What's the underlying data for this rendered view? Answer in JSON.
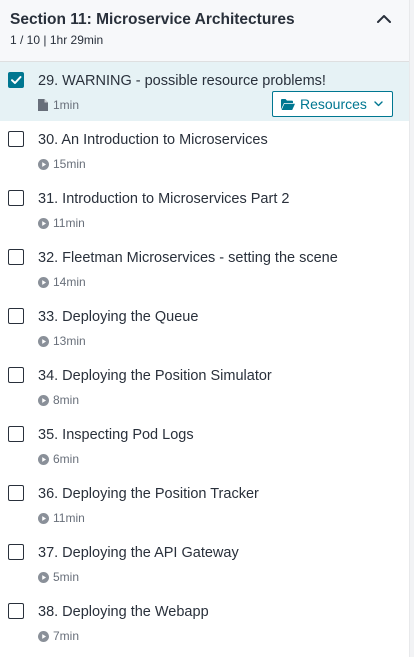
{
  "section": {
    "title": "Section 11: Microservice Architectures",
    "progress": "1 / 10",
    "separator": "|",
    "duration": "1hr 29min",
    "collapse_icon": "chevron-up-icon"
  },
  "colors": {
    "accent": "#007791",
    "active_row": "#e6f2f5",
    "header_bg": "#f7f8fa",
    "text": "#29303b",
    "muted": "#686f7a"
  },
  "resources": {
    "label": "Resources",
    "icon": "folder-open-icon",
    "chevron": "chevron-down-icon"
  },
  "lectures": [
    {
      "title": "29. WARNING - possible resource problems!",
      "duration": "1min",
      "completed": true,
      "type": "article",
      "icon": "file-icon"
    },
    {
      "title": "30. An Introduction to Microservices",
      "duration": "15min",
      "completed": false,
      "type": "video",
      "icon": "play-circle-icon"
    },
    {
      "title": "31. Introduction to Microservices Part 2",
      "duration": "11min",
      "completed": false,
      "type": "video",
      "icon": "play-circle-icon"
    },
    {
      "title": "32. Fleetman Microservices - setting the scene",
      "duration": "14min",
      "completed": false,
      "type": "video",
      "icon": "play-circle-icon"
    },
    {
      "title": "33. Deploying the Queue",
      "duration": "13min",
      "completed": false,
      "type": "video",
      "icon": "play-circle-icon"
    },
    {
      "title": "34. Deploying the Position Simulator",
      "duration": "8min",
      "completed": false,
      "type": "video",
      "icon": "play-circle-icon"
    },
    {
      "title": "35. Inspecting Pod Logs",
      "duration": "6min",
      "completed": false,
      "type": "video",
      "icon": "play-circle-icon"
    },
    {
      "title": "36. Deploying the Position Tracker",
      "duration": "11min",
      "completed": false,
      "type": "video",
      "icon": "play-circle-icon"
    },
    {
      "title": "37. Deploying the API Gateway",
      "duration": "5min",
      "completed": false,
      "type": "video",
      "icon": "play-circle-icon"
    },
    {
      "title": "38. Deploying the Webapp",
      "duration": "7min",
      "completed": false,
      "type": "video",
      "icon": "play-circle-icon"
    }
  ]
}
